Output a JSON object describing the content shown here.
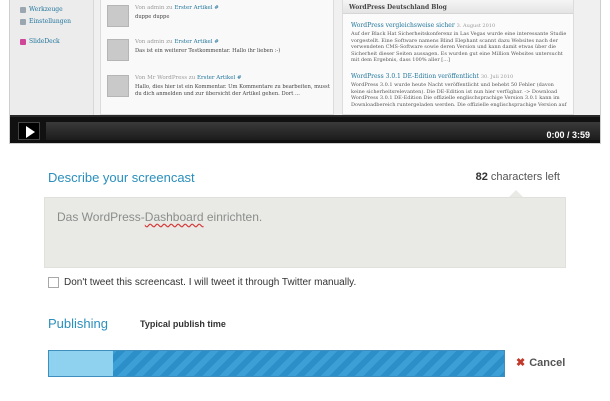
{
  "video": {
    "sidebar": [
      "Werkzeuge",
      "Einstellungen",
      "SlideDeck"
    ],
    "comments": [
      {
        "meta_prefix": "Von admin zu",
        "meta_link": "Erster Artikel #",
        "text": "duppe duppe"
      },
      {
        "meta_prefix": "Von admin zu",
        "meta_link": "Erster Artikel #",
        "text": "Das ist ein weiterer Testkommentar. Hallo ihr lieben :-)"
      },
      {
        "meta_prefix": "Von Mr WordPress zu",
        "meta_link": "Erster Artikel #",
        "text": "Hallo, dies hier ist ein Kommentar. Um Kommentare zu bearbeiten, musst du dich anmelden und zur übersicht der Artikel gehen. Dort ..."
      }
    ],
    "blog": {
      "title": "WordPress Deutschland Blog",
      "posts": [
        {
          "title": "WordPress vergleichsweise sicher",
          "date": "3. August 2010",
          "text": "Auf der Black Hat Sicherheitskonferenz in Las Vegas wurde eine interessante Studie vorgestellt. Eine Software namens Blind Elephant scannt dazu Websites nach der verwendeten CMS-Software sowie deren Version und kann damit etwas über die Sicherheit dieser Seiten aussagen. Es wurden gut eine Million Websites untersucht mit dem Ergebnis, dass 100% aller [...]"
        },
        {
          "title": "WordPress 3.0.1 DE-Edition veröffentlicht",
          "date": "30. Juli 2010",
          "text": "WordPress 3.0.1 wurde heute Nacht veröffentlicht und behebt 50 Fehler (davon keine sicherheitsrelevanten). Die DE-Edition ist nun hier verfügbar. -> Download WordPress 3.0.1 DE-Edition Die offizielle englischsprachige Version 3.0.1 kann im Downloadbereich runtergeladen werden. Die offizielle englischsprachige Version auf"
        }
      ]
    },
    "time": "0:00 / 3:59"
  },
  "describe": {
    "title": "Describe your screencast",
    "count": "82",
    "count_suffix": "characters left",
    "text_before": "Das WordPress-",
    "text_flagged": "Dashboard",
    "text_after": " einrichten."
  },
  "tweet": {
    "label": "Don't tweet this screencast. I will tweet it through Twitter manually.",
    "checked": false
  },
  "publishing": {
    "title": "Publishing",
    "typical_time": "Typical publish time",
    "progress": 0.14,
    "cancel_label": "Cancel"
  }
}
